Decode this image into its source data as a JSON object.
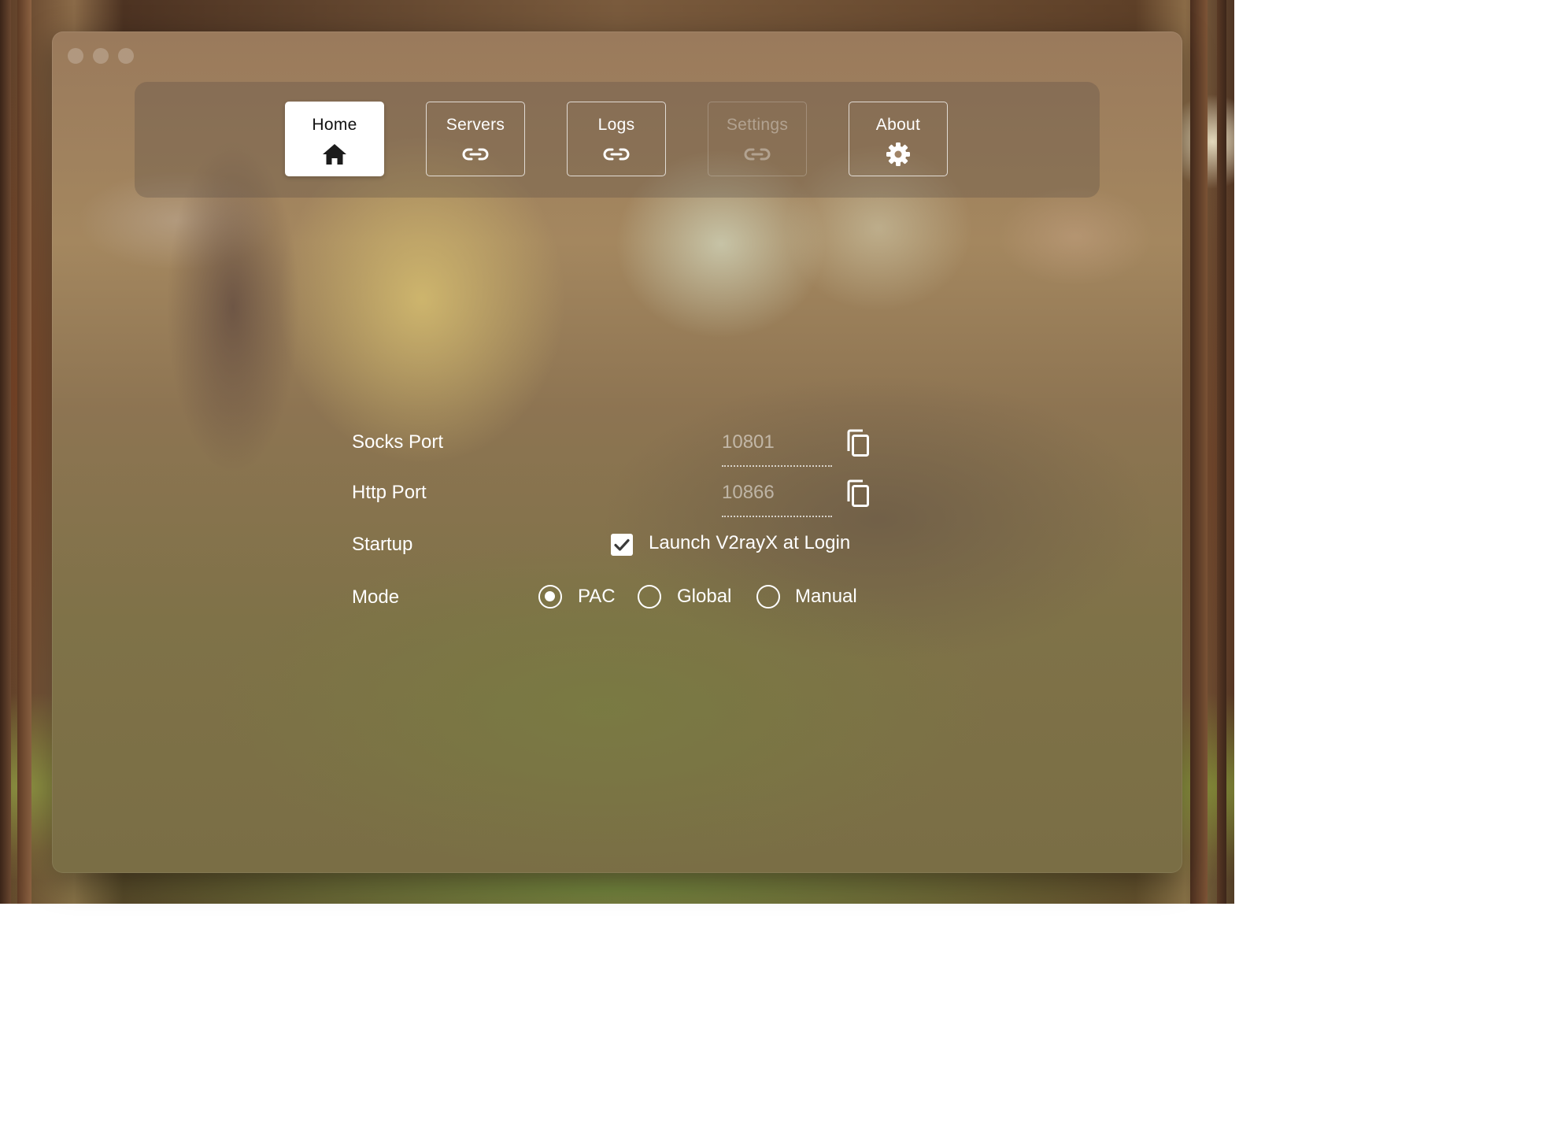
{
  "window": {
    "traffic_lights": [
      "close-button",
      "minimize-button",
      "zoom-button"
    ]
  },
  "tabs": [
    {
      "label": "Home",
      "icon": "home-icon",
      "state": "active"
    },
    {
      "label": "Servers",
      "icon": "link-icon",
      "state": "normal"
    },
    {
      "label": "Logs",
      "icon": "link-icon",
      "state": "normal"
    },
    {
      "label": "Settings",
      "icon": "link-icon",
      "state": "disabled"
    },
    {
      "label": "About",
      "icon": "gear-icon",
      "state": "normal"
    }
  ],
  "home": {
    "socks_port": {
      "label": "Socks Port",
      "value": "10801",
      "action_icon": "copy-icon"
    },
    "http_port": {
      "label": "Http Port",
      "value": "10866",
      "action_icon": "copy-icon"
    },
    "startup": {
      "label": "Startup",
      "option_label": "Launch V2rayX at Login",
      "checked": true
    },
    "mode": {
      "label": "Mode",
      "selected": "PAC",
      "options": [
        "PAC",
        "Global",
        "Manual"
      ]
    }
  },
  "colors": {
    "accent": "#ffffff",
    "active_tab_bg": "#ffffff",
    "active_tab_text": "#111111",
    "disabled_text": "rgba(255,255,255,0.35)"
  }
}
